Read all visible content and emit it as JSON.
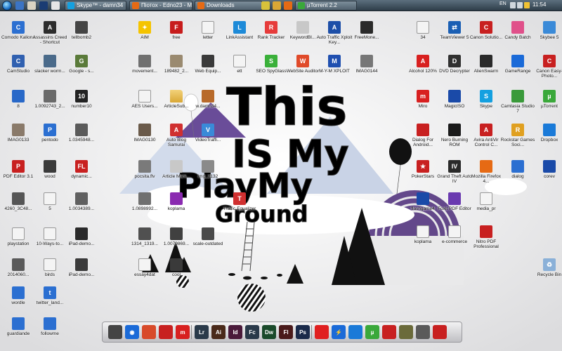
{
  "taskbar": {
    "quicklaunch": [
      {
        "name": "show-desktop-quicklaunch-icon",
        "color": "#3b74c4"
      },
      {
        "name": "paint-quicklaunch-icon",
        "color": "#d9d3c2"
      },
      {
        "name": "photoshop-quicklaunch-icon",
        "color": "#1a3c73"
      },
      {
        "name": "pointer-quicklaunch-icon",
        "color": "#e6e6e6"
      }
    ],
    "tasks": [
      {
        "name": "task-skype",
        "label": "Skype™ - damn34",
        "color": "#14a0e0"
      },
      {
        "name": "task-firefox-seotox",
        "label": "Пiотох - Edno23 - M...",
        "color": "#e66a14"
      },
      {
        "name": "task-downloads",
        "label": "Downloads",
        "color": "#e66a14"
      },
      {
        "name": "task-utorrent",
        "label": "µTorrent 2.2",
        "color": "#3aa83a"
      }
    ],
    "taskbar_small_icons": [
      {
        "name": "chrome-taskbar-icon",
        "color": "#d8c23a"
      },
      {
        "name": "folder-taskbar-icon",
        "color": "#d9a735"
      },
      {
        "name": "firefox-taskbar-icon",
        "color": "#e66a14"
      }
    ],
    "tray": {
      "lang": "EN",
      "icons": [
        {
          "name": "tray-network-icon",
          "color": "#cfd7dd"
        },
        {
          "name": "tray-volume-icon",
          "color": "#cfd7dd"
        },
        {
          "name": "tray-flag-icon",
          "color": "#f1c232"
        }
      ],
      "clock": "11:54"
    }
  },
  "icons": [
    {
      "name": "icon-comodo-kaliona",
      "label": "Comodo Kaliona",
      "kind": "app",
      "color": "#2b6fd1",
      "glyph": "C"
    },
    {
      "name": "icon-assassins-creed",
      "label": "Assassins Creed - Shortcut",
      "kind": "app",
      "color": "#2d2d2d",
      "glyph": "A"
    },
    {
      "name": "icon-tellbomb2",
      "label": "tellbomb2",
      "kind": "app",
      "color": "#444444",
      "glyph": ""
    },
    {
      "name": "icon-aim",
      "label": "AIM",
      "kind": "app",
      "color": "#f5c400",
      "glyph": "✦"
    },
    {
      "name": "icon-free",
      "label": "free",
      "kind": "app",
      "color": "#c71c1c",
      "glyph": "F"
    },
    {
      "name": "icon-letter",
      "label": "letter",
      "kind": "file",
      "color": "#ffffff",
      "glyph": ""
    },
    {
      "name": "icon-linkassistant",
      "label": "LinkAssistant",
      "kind": "app",
      "color": "#1d8ad8",
      "glyph": "L"
    },
    {
      "name": "icon-rank-tracker",
      "label": "Rank Tracker",
      "kind": "app",
      "color": "#e63b3b",
      "glyph": "R"
    },
    {
      "name": "icon-keywordbl",
      "label": "KeywordBl...",
      "kind": "app",
      "color": "#c8c8c8",
      "glyph": ""
    },
    {
      "name": "icon-auto-traffic",
      "label": "Auto Traffic Xploit Key...",
      "kind": "app",
      "color": "#1d4fa8",
      "glyph": "A"
    },
    {
      "name": "icon-freemon",
      "label": "FreeMone...",
      "kind": "app",
      "color": "#2a2a2a",
      "glyph": ""
    },
    {
      "name": "icon-camstudio",
      "label": "CamStudio",
      "kind": "app",
      "color": "#3060b0",
      "glyph": "C"
    },
    {
      "name": "icon-slacker-worm",
      "label": "slacker worm...",
      "kind": "app",
      "color": "#4a6a8a",
      "glyph": ""
    },
    {
      "name": "icon-google-ads",
      "label": "Google - s...",
      "kind": "app",
      "color": "#5a7a3a",
      "glyph": "G"
    },
    {
      "name": "icon-movement",
      "label": "movement...",
      "kind": "app",
      "color": "#707070",
      "glyph": ""
    },
    {
      "name": "icon-img-189482",
      "label": "189482_2...",
      "kind": "app",
      "color": "#9a8a70",
      "glyph": ""
    },
    {
      "name": "icon-web-equip",
      "label": "Web Equip...",
      "kind": "app",
      "color": "#3a3a3a",
      "glyph": ""
    },
    {
      "name": "icon-ett",
      "label": "ett",
      "kind": "file",
      "color": "#ffffff",
      "glyph": ""
    },
    {
      "name": "icon-seo-spyglass",
      "label": "SEO SpyGlass",
      "kind": "app",
      "color": "#3ab03a",
      "glyph": "S"
    },
    {
      "name": "icon-website-auditor",
      "label": "WebSite Auditor",
      "kind": "app",
      "color": "#e04a2a",
      "glyph": "W"
    },
    {
      "name": "icon-m-m-xploit",
      "label": "M-Y-M XPLOIT",
      "kind": "app",
      "color": "#2050b0",
      "glyph": "M"
    },
    {
      "name": "icon-imag0144",
      "label": "IMAG0144",
      "kind": "app",
      "color": "#777777",
      "glyph": ""
    },
    {
      "name": "icon-8",
      "label": "8",
      "kind": "app",
      "color": "#2868c8",
      "glyph": ""
    },
    {
      "name": "icon-img-10092743",
      "label": "1.0092743_2...",
      "kind": "app",
      "color": "#6a6a6a",
      "glyph": ""
    },
    {
      "name": "icon-number10",
      "label": "number10",
      "kind": "app",
      "color": "#222222",
      "glyph": "10"
    },
    {
      "name": "icon-aes-users",
      "label": "AES Users...",
      "kind": "file",
      "color": "#ffffff",
      "glyph": ""
    },
    {
      "name": "icon-articlesub",
      "label": "ArticleSub...",
      "kind": "folder",
      "color": "#d9a735",
      "glyph": ""
    },
    {
      "name": "icon-web-damn34",
      "label": "w.damn34...",
      "kind": "app",
      "color": "#b86a2a",
      "glyph": ""
    },
    {
      "name": "icon-imag0133",
      "label": "IMAG0133",
      "kind": "app",
      "color": "#8a7a6a",
      "glyph": ""
    },
    {
      "name": "icon-pentodo",
      "label": "pentodo",
      "kind": "app",
      "color": "#2b6fd1",
      "glyph": "P"
    },
    {
      "name": "icon-img-10345948",
      "label": "1.0345948...",
      "kind": "app",
      "color": "#5a5a5a",
      "glyph": ""
    },
    {
      "name": "icon-imag0130",
      "label": "IMAG0130",
      "kind": "app",
      "color": "#6a5a4a",
      "glyph": ""
    },
    {
      "name": "icon-auto-blog",
      "label": "Auto Blog Samurai",
      "kind": "app",
      "color": "#d03030",
      "glyph": "A"
    },
    {
      "name": "icon-video-traffic",
      "label": "VideoTraffi...",
      "kind": "app",
      "color": "#3a8ad8",
      "glyph": "V"
    },
    {
      "name": "icon-pdf-editor",
      "label": "PDF Editor 3.1",
      "kind": "app",
      "color": "#c82020",
      "glyph": "P"
    },
    {
      "name": "icon-wood",
      "label": "wood",
      "kind": "app",
      "color": "#3a3a3a",
      "glyph": ""
    },
    {
      "name": "icon-dynamic",
      "label": "dynamic...",
      "kind": "app",
      "color": "#c82020",
      "glyph": "FL"
    },
    {
      "name": "icon-pocsita",
      "label": "pocsita.flv",
      "kind": "app",
      "color": "#7a7a7a",
      "glyph": ""
    },
    {
      "name": "icon-article-marketing",
      "label": "Article Mark...",
      "kind": "app",
      "color": "#c8c8c8",
      "glyph": ""
    },
    {
      "name": "icon-img-2132",
      "label": "img_2132",
      "kind": "app",
      "color": "#8a8a8a",
      "glyph": ""
    },
    {
      "name": "icon-img-4260",
      "label": "4260_3C48...",
      "kind": "app",
      "color": "#555555",
      "glyph": ""
    },
    {
      "name": "icon-file-5",
      "label": "5",
      "kind": "file",
      "color": "#ffffff",
      "glyph": ""
    },
    {
      "name": "icon-img-10034389",
      "label": "1.0034389...",
      "kind": "app",
      "color": "#606060",
      "glyph": ""
    },
    {
      "name": "icon-img-10898992",
      "label": "1.0898992...",
      "kind": "app",
      "color": "#707070",
      "glyph": ""
    },
    {
      "name": "icon-koplama",
      "label": "koplama",
      "kind": "app",
      "color": "#8a2ab0",
      "glyph": ""
    },
    {
      "name": "icon-traffic-equalizer",
      "label": "Traffic Equalizer",
      "kind": "app",
      "color": "#d03030",
      "glyph": "T"
    },
    {
      "name": "icon-playstation",
      "label": "playstation",
      "kind": "file",
      "color": "#ffffff",
      "glyph": ""
    },
    {
      "name": "icon-10-ways",
      "label": "10-Ways-to...",
      "kind": "file",
      "color": "#ffffff",
      "glyph": ""
    },
    {
      "name": "icon-ipad-demo",
      "label": "iPad-demo...",
      "kind": "app",
      "color": "#2a2a2a",
      "glyph": ""
    },
    {
      "name": "icon-img-1314",
      "label": "1314_1319...",
      "kind": "app",
      "color": "#505050",
      "glyph": ""
    },
    {
      "name": "icon-img-10079869",
      "label": "1.0079869...",
      "kind": "app",
      "color": "#404040",
      "glyph": ""
    },
    {
      "name": "icon-scale-outdated",
      "label": "scale-outdated",
      "kind": "app",
      "color": "#4a4a4a",
      "glyph": ""
    },
    {
      "name": "icon-img-20140608",
      "label": "2014060...",
      "kind": "app",
      "color": "#5a5a5a",
      "glyph": ""
    },
    {
      "name": "icon-birds",
      "label": "birds",
      "kind": "file",
      "color": "#ffffff",
      "glyph": ""
    },
    {
      "name": "icon-ipad-demo-2",
      "label": "iPad-demo...",
      "kind": "app",
      "color": "#3a3a3a",
      "glyph": ""
    },
    {
      "name": "icon-essay",
      "label": "essay4dat",
      "kind": "file",
      "color": "#ffffff",
      "glyph": ""
    },
    {
      "name": "icon-cool",
      "label": "cool",
      "kind": "app",
      "color": "#3a3a3a",
      "glyph": ""
    },
    {
      "name": "icon-wordle",
      "label": "wordle",
      "kind": "app",
      "color": "#2b6fd1",
      "glyph": ""
    },
    {
      "name": "icon-twitter-landing",
      "label": "twitter_land...",
      "kind": "app",
      "color": "#2b6fd1",
      "glyph": "t"
    },
    {
      "name": "icon-guardiande",
      "label": "guardiande",
      "kind": "app",
      "color": "#2b6fd1",
      "glyph": ""
    },
    {
      "name": "icon-followme",
      "label": "followme",
      "kind": "app",
      "color": "#2b6fd1",
      "glyph": ""
    },
    {
      "name": "icon-file-34",
      "label": "34",
      "kind": "file",
      "color": "#ffffff",
      "glyph": ""
    },
    {
      "name": "icon-teamviewer",
      "label": "TeamViewer 5",
      "kind": "app",
      "color": "#1a5fb4",
      "glyph": "⇄"
    },
    {
      "name": "icon-canon-solution",
      "label": "Canon Solutio...",
      "kind": "app",
      "color": "#c82020",
      "glyph": "C"
    },
    {
      "name": "icon-candy-batch",
      "label": "Candy Batch",
      "kind": "app",
      "color": "#e0508a",
      "glyph": ""
    },
    {
      "name": "icon-skybee",
      "label": "Skybee 5",
      "kind": "app",
      "color": "#3a8ad8",
      "glyph": ""
    },
    {
      "name": "icon-alcohol",
      "label": "Alcohol 120%",
      "kind": "app",
      "color": "#d82020",
      "glyph": "A"
    },
    {
      "name": "icon-dvd-decrypter",
      "label": "DVD Decrypter",
      "kind": "app",
      "color": "#303030",
      "glyph": "D"
    },
    {
      "name": "icon-alienware",
      "label": "AlienSwarm",
      "kind": "app",
      "color": "#2a2a2a",
      "glyph": ""
    },
    {
      "name": "icon-gamerange",
      "label": "GameRange",
      "kind": "app",
      "color": "#1a6ad8",
      "glyph": ""
    },
    {
      "name": "icon-canon-easy",
      "label": "Canon Easy-Photo...",
      "kind": "app",
      "color": "#c82020",
      "glyph": "C"
    },
    {
      "name": "icon-miro",
      "label": "Miro",
      "kind": "app",
      "color": "#d82020",
      "glyph": "m"
    },
    {
      "name": "icon-magiciso",
      "label": "MagicISO",
      "kind": "app",
      "color": "#1a4aa8",
      "glyph": ""
    },
    {
      "name": "icon-skype",
      "label": "Skype",
      "kind": "app",
      "color": "#14a0e0",
      "glyph": "S"
    },
    {
      "name": "icon-camtasia",
      "label": "Camtasia Studio 7",
      "kind": "app",
      "color": "#3a9a3a",
      "glyph": ""
    },
    {
      "name": "icon-utorrent",
      "label": "µTorrent",
      "kind": "app",
      "color": "#3aa83a",
      "glyph": "µ"
    },
    {
      "name": "icon-dialog-for-android",
      "label": "Dialog For Android...",
      "kind": "app",
      "color": "#c82020",
      "glyph": ""
    },
    {
      "name": "icon-nero",
      "label": "Nero Burning ROM",
      "kind": "app",
      "color": "#1a1a1a",
      "glyph": ""
    },
    {
      "name": "icon-avira",
      "label": "Avira AntiVir Control C...",
      "kind": "app",
      "color": "#c82020",
      "glyph": "A"
    },
    {
      "name": "icon-rockstar",
      "label": "Rockstar Games Soci...",
      "kind": "app",
      "color": "#e0a020",
      "glyph": "R"
    },
    {
      "name": "icon-dropbox",
      "label": "Dropbox",
      "kind": "app",
      "color": "#1a7ad8",
      "glyph": ""
    },
    {
      "name": "icon-pokerstars",
      "label": "PokerStars",
      "kind": "app",
      "color": "#c82020",
      "glyph": "★"
    },
    {
      "name": "icon-gta4",
      "label": "Grand Theft Auto IV",
      "kind": "app",
      "color": "#2a2a2a",
      "glyph": "IV"
    },
    {
      "name": "icon-mozilla-firefox",
      "label": "Mozilla Firefox 4...",
      "kind": "app",
      "color": "#e66a14",
      "glyph": ""
    },
    {
      "name": "icon-dialog",
      "label": "dialog",
      "kind": "app",
      "color": "#2b6fd1",
      "glyph": ""
    },
    {
      "name": "icon-corev",
      "label": "corev",
      "kind": "app",
      "color": "#1a4aa8",
      "glyph": ""
    },
    {
      "name": "icon-flashgame4",
      "label": "flashgame4",
      "kind": "app",
      "color": "#1a4aa8",
      "glyph": ""
    },
    {
      "name": "icon-foxit-pdf",
      "label": "Foxit PDF Editor",
      "kind": "app",
      "color": "#6a3ab0",
      "glyph": ""
    },
    {
      "name": "icon-media-pr",
      "label": "media_pr",
      "kind": "file",
      "color": "#ffffff",
      "glyph": ""
    },
    {
      "name": "icon-koplama-2",
      "label": "koplama",
      "kind": "file",
      "color": "#ffffff",
      "glyph": ""
    },
    {
      "name": "icon-e-commerce",
      "label": "e-commerce",
      "kind": "file",
      "color": "#ffffff",
      "glyph": ""
    },
    {
      "name": "icon-nitro-pdf",
      "label": "Nitro PDF Professional",
      "kind": "app",
      "color": "#c82020",
      "glyph": ""
    },
    {
      "name": "icon-recycle-bin",
      "label": "Recycle Bin",
      "kind": "app",
      "color": "#8ab0d8",
      "glyph": "♻"
    }
  ],
  "dock": {
    "items": [
      {
        "name": "dock-finder-icon",
        "glyph": "",
        "color": "#444444"
      },
      {
        "name": "dock-earth-icon",
        "glyph": "◉",
        "color": "#1a6ad8"
      },
      {
        "name": "dock-chrome-icon",
        "glyph": "",
        "color": "#d84a2a"
      },
      {
        "name": "dock-acrobat-icon",
        "glyph": "",
        "color": "#c82020"
      },
      {
        "name": "dock-miro-icon",
        "glyph": "m",
        "color": "#d82020"
      },
      {
        "name": "dock-lightroom-icon",
        "glyph": "Lr",
        "color": "#2a3a4a"
      },
      {
        "name": "dock-illustrator-icon",
        "glyph": "Ai",
        "color": "#4a2a1a"
      },
      {
        "name": "dock-indesign-icon",
        "glyph": "Id",
        "color": "#4a1a3a"
      },
      {
        "name": "dock-flash-catalyst-icon",
        "glyph": "Fc",
        "color": "#2a3a4a"
      },
      {
        "name": "dock-dreamweaver-icon",
        "glyph": "Dw",
        "color": "#1a4a2a"
      },
      {
        "name": "dock-flash-icon",
        "glyph": "Fl",
        "color": "#4a1a1a"
      },
      {
        "name": "dock-photoshop-icon",
        "glyph": "Ps",
        "color": "#1a2a4a"
      },
      {
        "name": "dock-vodafone-icon",
        "glyph": "",
        "color": "#e02020"
      },
      {
        "name": "dock-bolt-icon",
        "glyph": "⚡",
        "color": "#1a6ad8"
      },
      {
        "name": "dock-dropbox-icon",
        "glyph": "",
        "color": "#1a7ad8"
      },
      {
        "name": "dock-utorrent-icon",
        "glyph": "µ",
        "color": "#3aa83a"
      },
      {
        "name": "dock-game-red-icon",
        "glyph": "",
        "color": "#c82020"
      },
      {
        "name": "dock-fallout-icon",
        "glyph": "",
        "color": "#6a6a3a"
      },
      {
        "name": "dock-triangle-icon",
        "glyph": "",
        "color": "#5a5a5a"
      },
      {
        "name": "dock-red-app-icon",
        "glyph": "",
        "color": "#c82020"
      }
    ]
  },
  "wallpaper": {
    "line1": "This",
    "line2": "IS My",
    "line3": "PlayMy",
    "line4": "Ground",
    "accent_purple": "#4a2a78",
    "ink": "#000000"
  }
}
